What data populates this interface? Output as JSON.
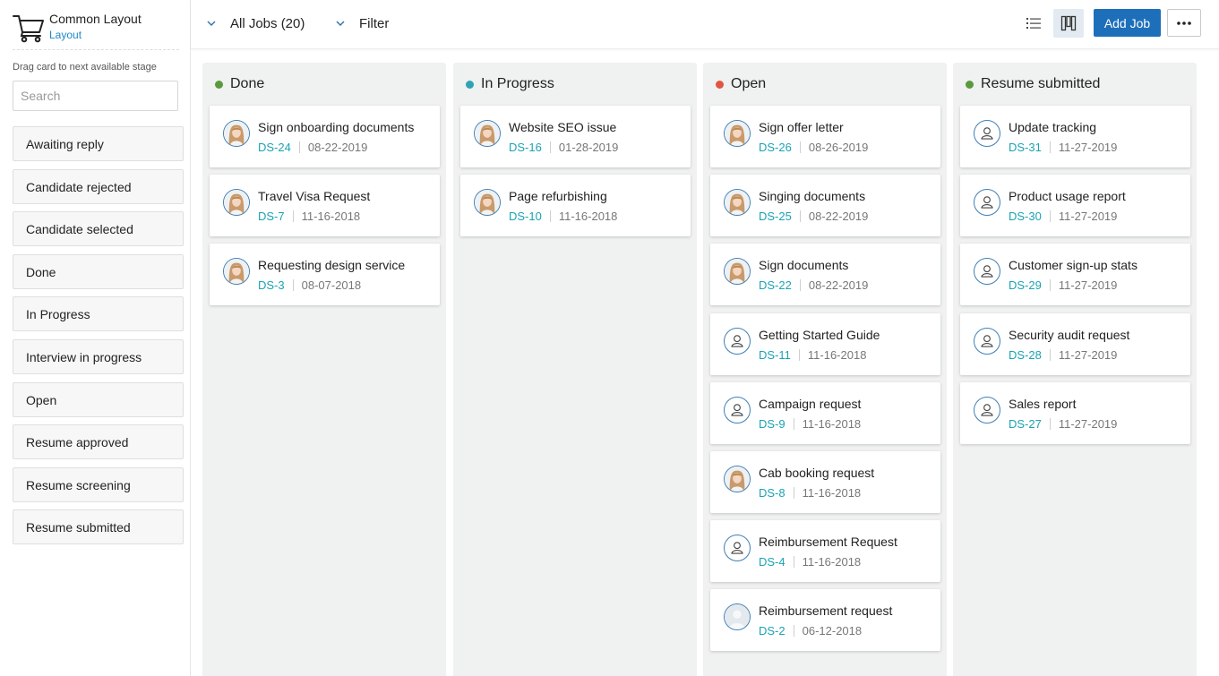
{
  "brand": {
    "title": "Common Layout",
    "subtitle": "Layout"
  },
  "sidebar": {
    "drag_hint": "Drag card to next available stage",
    "search_placeholder": "Search",
    "stages": [
      {
        "label": "Awaiting reply"
      },
      {
        "label": "Candidate rejected"
      },
      {
        "label": "Candidate selected"
      },
      {
        "label": "Done"
      },
      {
        "label": "In Progress"
      },
      {
        "label": "Interview in progress"
      },
      {
        "label": "Open"
      },
      {
        "label": "Resume approved"
      },
      {
        "label": "Resume screening"
      },
      {
        "label": "Resume submitted"
      }
    ]
  },
  "toolbar": {
    "jobs_filter": "All Jobs  (20)",
    "filter_label": "Filter",
    "add_job_label": "Add Job",
    "list_view_icon": "list-icon",
    "board_view_icon": "kanban-icon",
    "more_icon": "ellipsis-icon"
  },
  "colors": {
    "done": "#5a9a3c",
    "in_progress": "#2ea3b5",
    "open": "#e2553f",
    "resume_submitted": "#5a9a3c",
    "accent": "#1e6fba",
    "id_text": "#1aa3b4"
  },
  "columns": [
    {
      "title": "Done",
      "cards": [
        {
          "title": "Sign onboarding documents",
          "id": "DS-24",
          "date": "08-22-2019",
          "avatar": "photo"
        },
        {
          "title": "Travel Visa Request",
          "id": "DS-7",
          "date": "11-16-2018",
          "avatar": "photo"
        },
        {
          "title": "Requesting design service",
          "id": "DS-3",
          "date": "08-07-2018",
          "avatar": "photo"
        }
      ]
    },
    {
      "title": "In Progress",
      "cards": [
        {
          "title": "Website SEO issue",
          "id": "DS-16",
          "date": "01-28-2019",
          "avatar": "photo"
        },
        {
          "title": "Page refurbishing",
          "id": "DS-10",
          "date": "11-16-2018",
          "avatar": "photo"
        }
      ]
    },
    {
      "title": "Open",
      "cards": [
        {
          "title": "Sign offer letter",
          "id": "DS-26",
          "date": "08-26-2019",
          "avatar": "photo"
        },
        {
          "title": "Singing documents",
          "id": "DS-25",
          "date": "08-22-2019",
          "avatar": "photo"
        },
        {
          "title": "Sign documents",
          "id": "DS-22",
          "date": "08-22-2019",
          "avatar": "photo"
        },
        {
          "title": "Getting Started Guide",
          "id": "DS-11",
          "date": "11-16-2018",
          "avatar": "user-icon"
        },
        {
          "title": "Campaign request",
          "id": "DS-9",
          "date": "11-16-2018",
          "avatar": "user-icon"
        },
        {
          "title": "Cab booking request",
          "id": "DS-8",
          "date": "11-16-2018",
          "avatar": "photo"
        },
        {
          "title": "Reimbursement Request",
          "id": "DS-4",
          "date": "11-16-2018",
          "avatar": "user-icon"
        },
        {
          "title": "Reimbursement request",
          "id": "DS-2",
          "date": "06-12-2018",
          "avatar": "blank"
        }
      ]
    },
    {
      "title": "Resume submitted",
      "cards": [
        {
          "title": "Update tracking",
          "id": "DS-31",
          "date": "11-27-2019",
          "avatar": "user-icon"
        },
        {
          "title": "Product usage report",
          "id": "DS-30",
          "date": "11-27-2019",
          "avatar": "user-icon"
        },
        {
          "title": "Customer sign-up stats",
          "id": "DS-29",
          "date": "11-27-2019",
          "avatar": "user-icon"
        },
        {
          "title": "Security audit request",
          "id": "DS-28",
          "date": "11-27-2019",
          "avatar": "user-icon"
        },
        {
          "title": "Sales report",
          "id": "DS-27",
          "date": "11-27-2019",
          "avatar": "user-icon"
        }
      ]
    }
  ]
}
